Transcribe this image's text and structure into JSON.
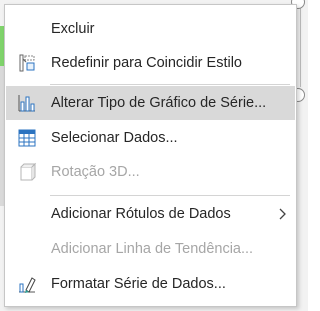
{
  "menu": {
    "items": [
      {
        "label": "Excluir",
        "icon": "none",
        "enabled": true
      },
      {
        "label": "Redefinir para Coincidir Estilo",
        "icon": "reset-style-icon",
        "enabled": true
      },
      {
        "label": "Alterar Tipo de Gráfico de Série...",
        "icon": "bar-chart-icon",
        "enabled": true,
        "highlighted": true
      },
      {
        "label": "Selecionar Dados...",
        "icon": "select-data-icon",
        "enabled": true
      },
      {
        "label": "Rotação 3D...",
        "icon": "rotation-3d-icon",
        "enabled": false
      },
      {
        "label": "Adicionar Rótulos de Dados",
        "icon": "none",
        "enabled": true,
        "submenu": true
      },
      {
        "label": "Adicionar Linha de Tendência...",
        "icon": "none",
        "enabled": false
      },
      {
        "label": "Formatar Série de Dados...",
        "icon": "format-series-icon",
        "enabled": true
      }
    ]
  },
  "colors": {
    "highlight": "#d9d9d9",
    "text": "#262626",
    "disabled_text": "#a6a6a6",
    "icon_blue": "#2b73c0",
    "icon_teal": "#2aa198"
  }
}
